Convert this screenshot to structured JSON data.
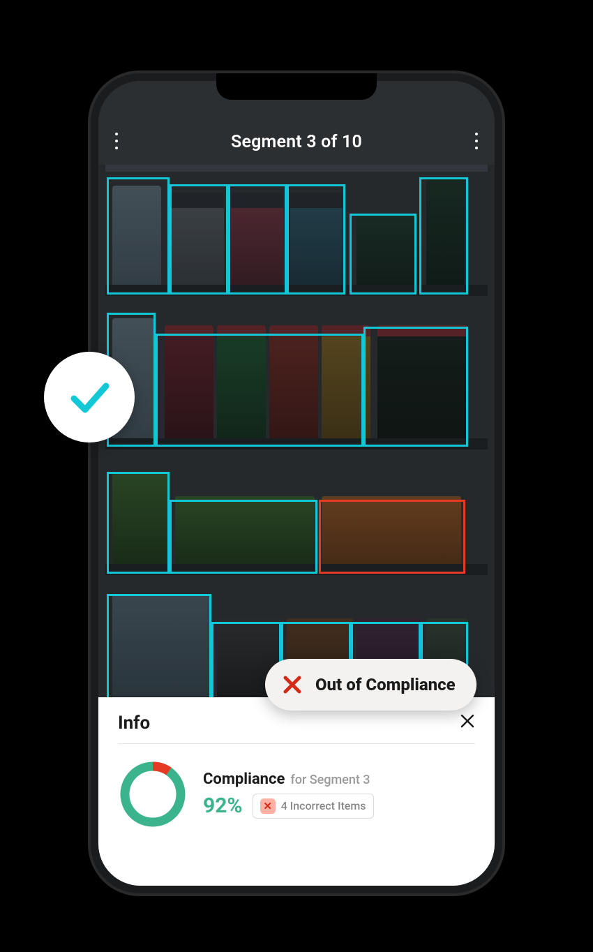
{
  "header": {
    "title": "Segment 3 of 10"
  },
  "alert": {
    "label": "Out of Compliance"
  },
  "info": {
    "title": "Info",
    "compliance_label": "Compliance",
    "compliance_sub": "for Segment 3",
    "percentage": "92%",
    "incorrect_label": "4 Incorrect Items",
    "incorrect_x": "✕"
  },
  "colors": {
    "accent": "#12c8d6",
    "error": "#e63a24",
    "success": "#3bb48e"
  },
  "compliance_value": 92,
  "incorrect_count": 4
}
